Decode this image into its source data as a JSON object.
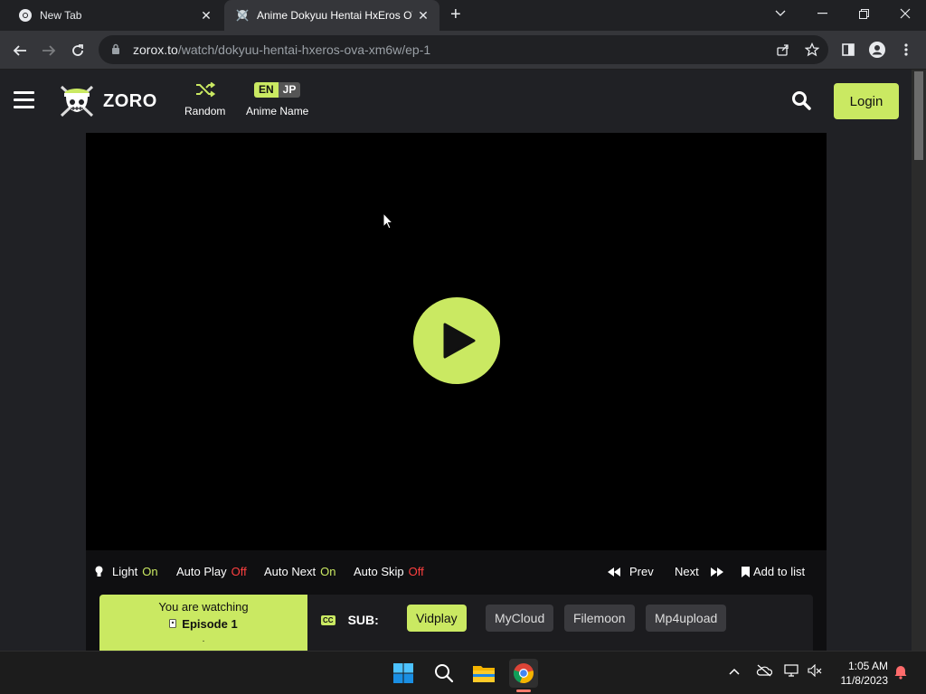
{
  "browser": {
    "tabs": [
      {
        "title": "New Tab",
        "active": false
      },
      {
        "title": "Anime Dokyuu Hentai HxEros OVA",
        "active": true
      }
    ],
    "url_host": "zorox.to",
    "url_path": "/watch/dokyuu-hentai-hxeros-ova-xm6w/ep-1"
  },
  "site": {
    "logo_text": "ZORO",
    "random_label": "Random",
    "lang_en": "EN",
    "lang_jp": "JP",
    "anime_name_label": "Anime Name",
    "login_label": "Login",
    "accent": "#cae962"
  },
  "controls": {
    "light_label": "Light",
    "light_value": "On",
    "autoplay_label": "Auto Play",
    "autoplay_value": "Off",
    "autonext_label": "Auto Next",
    "autonext_value": "On",
    "autoskip_label": "Auto Skip",
    "autoskip_value": "Off",
    "prev_label": "Prev",
    "next_label": "Next",
    "add_to_list_label": "Add to list"
  },
  "servers": {
    "watching_label": "You are watching",
    "episode_label": "Episode 1",
    "sub_label": "SUB:",
    "cc_badge": "CC",
    "list": [
      "Vidplay",
      "MyCloud",
      "Filemoon",
      "Mp4upload"
    ],
    "active": "Vidplay"
  },
  "taskbar": {
    "time": "1:05 AM",
    "date": "11/8/2023"
  }
}
